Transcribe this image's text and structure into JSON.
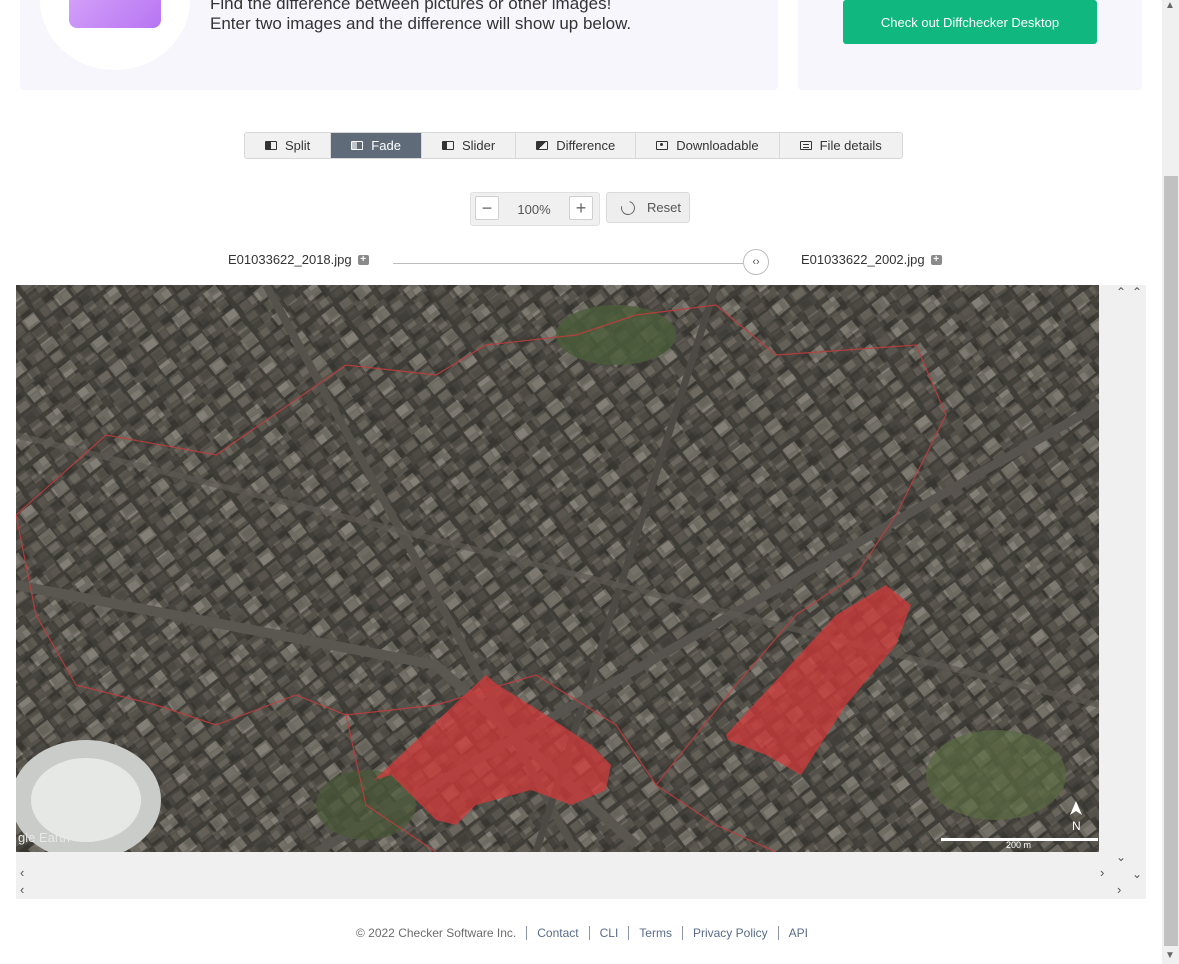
{
  "hero": {
    "line1": "Find the difference between pictures or other images!",
    "line2": "Enter two images and the difference will show up below."
  },
  "promo": {
    "button_label": "Check out Diffchecker Desktop"
  },
  "tabs": [
    {
      "label": "Split",
      "icon": "split-icon"
    },
    {
      "label": "Fade",
      "icon": "fade-icon",
      "active": true
    },
    {
      "label": "Slider",
      "icon": "slider-icon"
    },
    {
      "label": "Difference",
      "icon": "difference-icon"
    },
    {
      "label": "Downloadable",
      "icon": "image-icon"
    },
    {
      "label": "File details",
      "icon": "table-icon"
    }
  ],
  "zoom": {
    "minus": "−",
    "value": "100%",
    "plus": "+",
    "reset_label": "Reset"
  },
  "files": {
    "left": "E01033622_2018.jpg",
    "right": "E01033622_2002.jpg"
  },
  "fade_handle": "‹›",
  "map": {
    "watermark": "gle Earth",
    "scale": "200 m",
    "north": "N"
  },
  "footer": {
    "copyright": "© 2022 Checker Software Inc.",
    "links": [
      "Contact",
      "CLI",
      "Terms",
      "Privacy Policy",
      "API"
    ]
  }
}
